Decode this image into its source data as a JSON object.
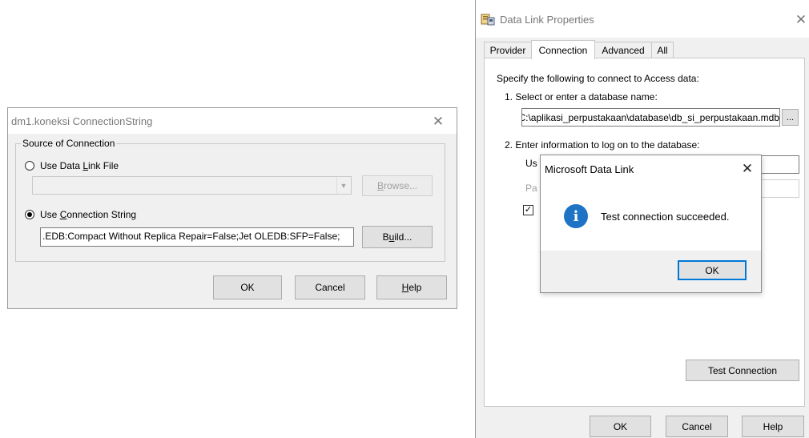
{
  "connection_string_dialog": {
    "title": "dm1.koneksi ConnectionString",
    "group_label": "Source of Connection",
    "data_link_file_label": "Use Data Link File",
    "data_link_file_value": "",
    "browse_label": "Browse...",
    "connection_string_label": "Use Connection String",
    "connection_string_value": ".EDB:Compact Without Replica Repair=False;Jet OLEDB:SFP=False;",
    "build_label": "Build...",
    "ok_label": "OK",
    "cancel_label": "Cancel",
    "help_label": "Help",
    "selected_option": "connection_string"
  },
  "data_link_properties": {
    "title": "Data Link Properties",
    "tabs": [
      "Provider",
      "Connection",
      "Advanced",
      "All"
    ],
    "active_tab": "Connection",
    "intro": "Specify the following to connect to Access data:",
    "step1": "1. Select or enter a database name:",
    "database_value": "C:\\aplikasi_perpustakaan\\database\\db_si_perpustakaan.mdb",
    "browse_dots": "...",
    "step2": "2. Enter information to log on to the database:",
    "username_label_partial": "Us",
    "password_label_partial": "Pa",
    "blank_password_checked": true,
    "checkmark": "✓",
    "test_connection_label": "Test Connection",
    "ok_label": "OK",
    "cancel_label": "Cancel",
    "help_label": "Help"
  },
  "message_box": {
    "title": "Microsoft Data Link",
    "message": "Test connection succeeded.",
    "icon": "info-icon",
    "info_glyph": "i",
    "ok_label": "OK"
  },
  "glyphs": {
    "close": "✕",
    "combo_arrow": "▼"
  },
  "colors": {
    "accent": "#0078d7",
    "info_icon": "#1e73c4",
    "dialog_bg": "#f0f0f0"
  }
}
